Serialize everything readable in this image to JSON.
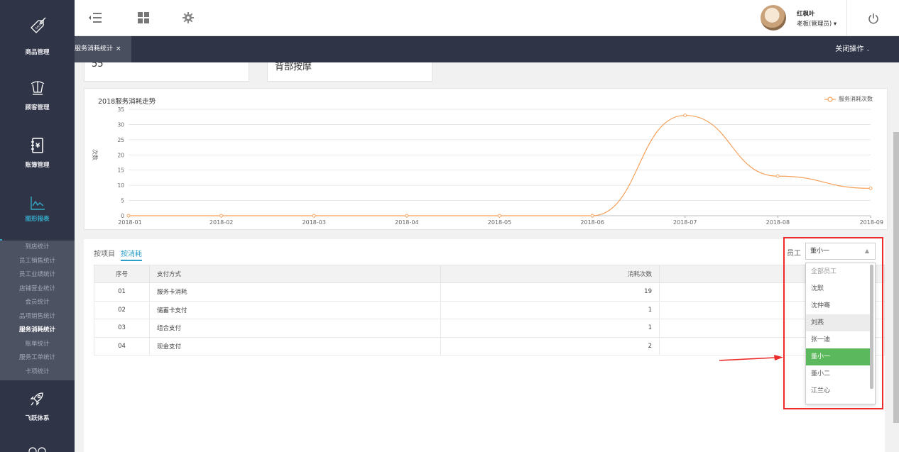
{
  "sidebar": {
    "items": [
      {
        "label": "商品管理",
        "icon": "sale-tag-icon"
      },
      {
        "label": "顾客管理",
        "icon": "crown-icon"
      },
      {
        "label": "账簿管理",
        "icon": "ledger-book-icon"
      },
      {
        "label": "图形报表",
        "icon": "line-chart-icon"
      },
      {
        "label": "飞跃体系",
        "icon": "rocket-icon"
      }
    ],
    "submenu": [
      "到店统计",
      "员工销售统计",
      "员工业绩统计",
      "店铺营业统计",
      "会员统计",
      "品项销售统计",
      "服务消耗统计",
      "账单统计",
      "服务工单统计",
      "卡项统计"
    ],
    "active_sub": "服务消耗统计"
  },
  "user": {
    "name": "红枫叶",
    "role": "老板(管理员) ▾"
  },
  "tabs": {
    "active": "服务消耗统计",
    "close": "×",
    "close_ops": "关闭操作"
  },
  "cards": {
    "count": "55",
    "service": "背部按摩"
  },
  "chart_data": {
    "type": "line",
    "title": "2018服务消耗走势",
    "ylabel": "次数",
    "xlabel": "",
    "legend": "服务消耗次数",
    "legend_position": "top-right",
    "categories": [
      "2018-01",
      "2018-02",
      "2018-03",
      "2018-04",
      "2018-05",
      "2018-06",
      "2018-07",
      "2018-08",
      "2018-09"
    ],
    "series": [
      {
        "name": "服务消耗次数",
        "values": [
          0,
          0,
          0,
          0,
          0,
          0,
          33,
          13,
          9
        ],
        "color": "#f6a05a"
      }
    ],
    "ylim": [
      0,
      35
    ],
    "yticks": [
      0,
      5,
      10,
      15,
      20,
      25,
      30,
      35
    ],
    "grid": true,
    "smooth": true
  },
  "table": {
    "tabs": [
      "按项目",
      "按消耗"
    ],
    "active_tab": "按消耗",
    "headers": [
      "序号",
      "支付方式",
      "消耗次数"
    ],
    "rows": [
      [
        "01",
        "服务卡消耗",
        "19"
      ],
      [
        "02",
        "储蓄卡支付",
        "1"
      ],
      [
        "03",
        "组合支付",
        "1"
      ],
      [
        "04",
        "现金支付",
        "2"
      ]
    ]
  },
  "staff": {
    "label": "员工",
    "selected": "董小一",
    "options": [
      "全部员工",
      "沈默",
      "沈仲骞",
      "刘燕",
      "张一迪",
      "董小一",
      "董小二",
      "江兰心"
    ],
    "hover": "刘燕"
  }
}
